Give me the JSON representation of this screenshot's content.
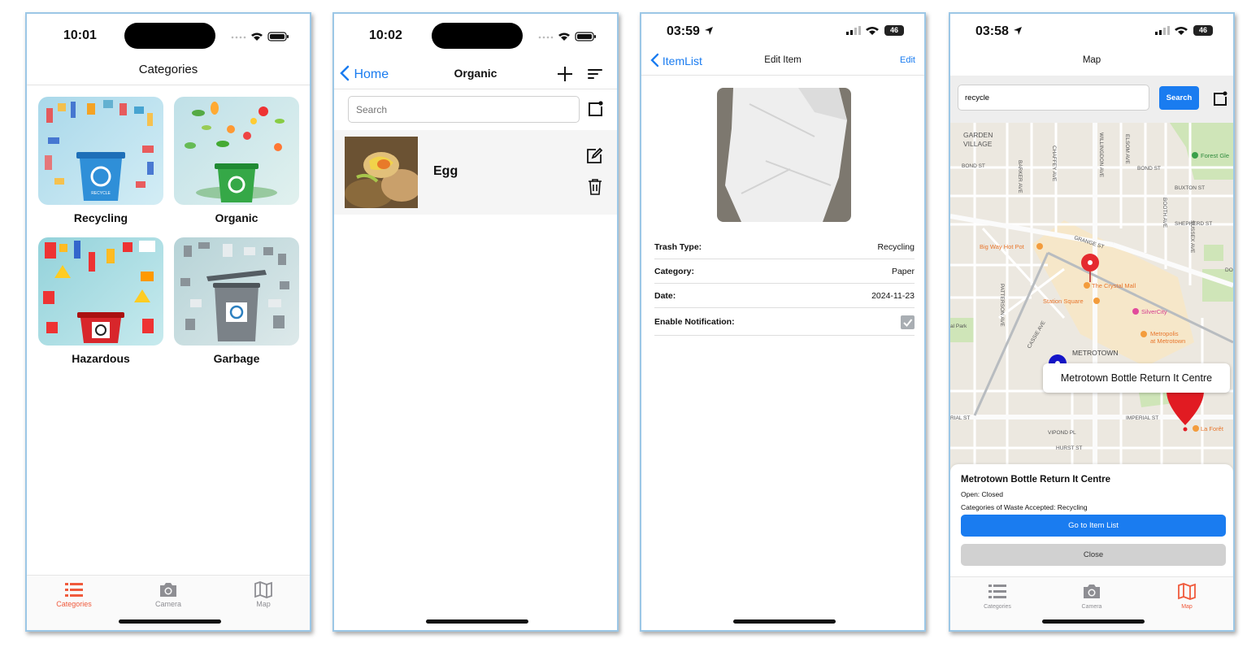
{
  "screen1": {
    "time": "10:01",
    "title": "Categories",
    "categories": [
      {
        "label": "Recycling",
        "icon": "recycling-bin-illustration",
        "bin_color": "#2f8fd8"
      },
      {
        "label": "Organic",
        "icon": "organic-bin-illustration",
        "bin_color": "#35a847"
      },
      {
        "label": "Hazardous",
        "icon": "hazardous-bin-illustration",
        "bin_color": "#d8262b"
      },
      {
        "label": "Garbage",
        "icon": "garbage-bin-illustration",
        "bin_color": "#7b8288"
      }
    ],
    "tabs": [
      {
        "label": "Categories",
        "icon": "list-icon",
        "active": true
      },
      {
        "label": "Camera",
        "icon": "camera-icon",
        "active": false
      },
      {
        "label": "Map",
        "icon": "map-icon",
        "active": false
      }
    ]
  },
  "screen2": {
    "time": "10:02",
    "back_label": "Home",
    "title": "Organic",
    "search_placeholder": "Search",
    "items": [
      {
        "name": "Egg",
        "thumbnail": "food-scraps-photo"
      }
    ]
  },
  "screen3": {
    "time": "03:59",
    "battery": "46",
    "back_label": "ItemList",
    "title": "Edit Item",
    "edit_label": "Edit",
    "photo": "white-paper-photo",
    "fields": [
      {
        "key": "Trash Type:",
        "value": "Recycling"
      },
      {
        "key": "Category:",
        "value": "Paper"
      },
      {
        "key": "Date:",
        "value": "2024-11-23"
      }
    ],
    "notification_label": "Enable Notification:",
    "notification_enabled": true
  },
  "screen4": {
    "time": "03:58",
    "battery": "46",
    "title": "Map",
    "search_value": "recycle",
    "search_button": "Search",
    "map_labels": {
      "garden_village": "GARDEN\nVILLAGE",
      "bond_st_1": "BOND ST",
      "bond_st_2": "BOND ST",
      "barker": "BARKER AVE",
      "chaffey": "CHAFFEY AVE",
      "willingdon": "WILLINGDON AVE",
      "elsom": "ELSOM AVE",
      "forest_glen": "Forest Gle",
      "buxton": "BUXTON ST",
      "booth": "BOOTH AVE",
      "sussex": "SUSSEX AVE",
      "shepherd": "SHEPHERD ST",
      "grange": "GRANGE ST",
      "big_way": "Big Way Hot Pot",
      "crystal_mall": "The Crystal Mall",
      "station_square": "Station Square",
      "silvercity": "SilverCity",
      "metropolis": "Metropolis\nat Metrotown",
      "metrotown": "METROTOWN",
      "patterson": "PATTERSON AVE",
      "cassie": "CASSIE AVE",
      "imperial_1": "RIAL ST",
      "imperial_2": "IMPERIAL ST",
      "vipond": "VIPOND PL",
      "hurst": "HURST ST",
      "la_foret": "La Forêt",
      "park": "al Park",
      "do": "DO"
    },
    "callout": "Metrotown Bottle Return It Centre",
    "sheet": {
      "title": "Metrotown Bottle Return It Centre",
      "open_line": "Open: Closed",
      "categories_line": "Categories of Waste Accepted: Recycling",
      "primary_button": "Go to Item List",
      "secondary_button": "Close"
    },
    "tabs": [
      {
        "label": "Categories",
        "icon": "list-icon",
        "active": false
      },
      {
        "label": "Camera",
        "icon": "camera-icon",
        "active": false
      },
      {
        "label": "Map",
        "icon": "map-icon",
        "active": true
      }
    ]
  },
  "colors": {
    "accent_blue": "#1a7cf0",
    "accent_tab": "#f05a3c",
    "map_bg": "#ece8e0",
    "mall_area": "#f6e7c9",
    "park": "#cfe5b8"
  }
}
